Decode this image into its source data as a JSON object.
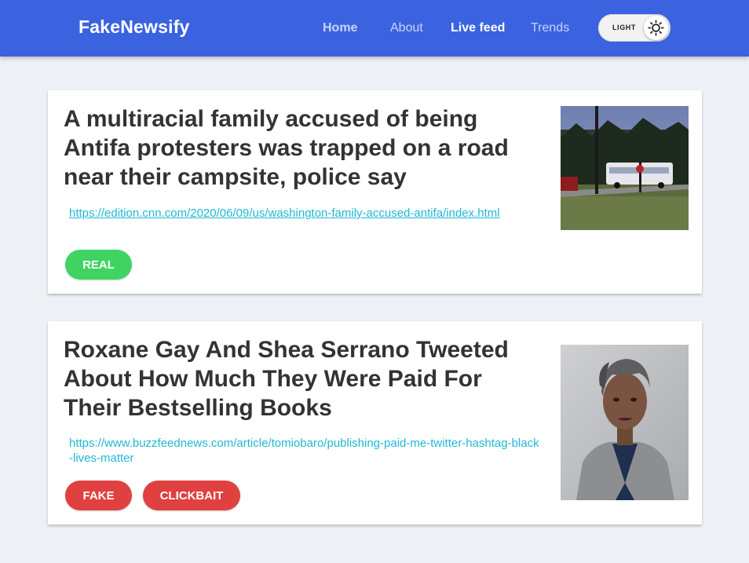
{
  "navbar": {
    "brand": "FakeNewsify",
    "links": [
      {
        "label": "Home"
      },
      {
        "label": "About"
      },
      {
        "label": "Live feed"
      },
      {
        "label": "Trends"
      }
    ],
    "theme_toggle_label": "LIGHT",
    "theme_icon": "sun-icon",
    "accent_color": "#3b63e0"
  },
  "articles": [
    {
      "headline": "A multiracial family accused of being Antifa protesters was trapped on a road near their campsite, police say",
      "url": "https://edition.cnn.com/2020/06/09/us/washington-family-accused-antifa/index.html",
      "labels": [
        "REAL"
      ],
      "label_colors": [
        "#3fd462"
      ],
      "image": "photo of a school bus parked on a wooded road"
    },
    {
      "headline": "Roxane Gay And Shea Serrano Tweeted About How Much They Were Paid For Their Bestselling Books",
      "url": "https://www.buzzfeednews.com/article/tomiobaro/publishing-paid-me-twitter-hashtag-black-lives-matter",
      "labels": [
        "FAKE",
        "CLICKBAIT"
      ],
      "label_colors": [
        "#e04040",
        "#e04040"
      ],
      "image": "portrait photo of a woman in a grey blazer"
    }
  ]
}
